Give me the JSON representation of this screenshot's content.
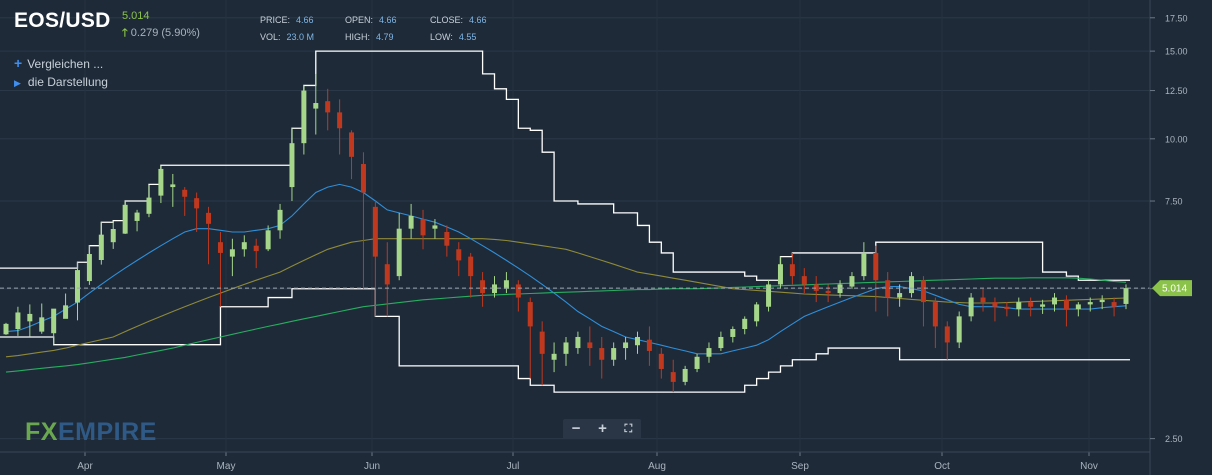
{
  "header": {
    "symbol": "EOS/USD",
    "last": "5.014",
    "change": "0.279 (5.90%)",
    "price_label": "PRICE:",
    "price": "4.66",
    "open_label": "OPEN:",
    "open": "4.66",
    "close_label": "CLOSE:",
    "close": "4.66",
    "vol_label": "VOL:",
    "vol": "23.0 M",
    "high_label": "HIGH:",
    "high": "4.79",
    "low_label": "LOW:",
    "low": "4.55"
  },
  "sidebar": {
    "compare": "Vergleichen ...",
    "display": "die Darstellung"
  },
  "logo": {
    "fx": "FX",
    "empire": "EMPIRE"
  },
  "zoom": {
    "minus": "−",
    "plus": "+",
    "fullscreen": "⛶"
  },
  "colors": {
    "background": "#1e2a38",
    "up": "#a5d68a",
    "down": "#c0391f",
    "ma_short": "#2f8fd8",
    "ma_mid": "#8e8a3a",
    "ma_long": "#27ae60",
    "channel": "#ffffff",
    "price_tag": "#8bc34a"
  },
  "chart_data": {
    "type": "candlestick",
    "y_scale": "log",
    "ylim": [
      2.35,
      19.0
    ],
    "y_ticks": [
      "2.50",
      "5.00",
      "7.50",
      "10.00",
      "12.50",
      "15.00",
      "17.50"
    ],
    "x_labels": [
      "Apr",
      "May",
      "Jun",
      "Jul",
      "Aug",
      "Sep",
      "Oct",
      "Nov"
    ],
    "last_price_tag": "5.014",
    "last_price": 5.014,
    "ohlc_shape": [
      [
        4.05,
        4.27,
        4.25,
        4.04
      ],
      [
        4.15,
        4.6,
        4.48,
        4.02
      ],
      [
        4.3,
        4.65,
        4.45,
        4.01
      ],
      [
        4.1,
        4.67,
        4.38,
        4.06
      ],
      [
        4.07,
        4.5,
        4.56,
        3.86
      ],
      [
        4.35,
        4.89,
        4.63,
        4.44
      ],
      [
        4.69,
        5.65,
        5.45,
        4.32
      ],
      [
        5.18,
        6.11,
        5.87,
        5.09
      ],
      [
        5.71,
        6.8,
        6.42,
        5.59
      ],
      [
        6.2,
        6.83,
        6.59,
        6.01
      ],
      [
        6.45,
        7.5,
        7.37,
        6.44
      ],
      [
        6.84,
        7.2,
        7.11,
        6.52
      ],
      [
        7.07,
        8.08,
        7.62,
        6.96
      ],
      [
        7.69,
        8.83,
        8.7,
        7.43
      ],
      [
        8.0,
        8.5,
        8.1,
        7.3
      ],
      [
        7.9,
        8.0,
        7.65,
        7.0
      ],
      [
        7.6,
        7.8,
        7.25,
        6.5
      ],
      [
        7.1,
        7.3,
        6.75,
        5.6
      ],
      [
        6.2,
        6.5,
        5.9,
        4.6
      ],
      [
        5.8,
        6.3,
        6.0,
        5.3
      ],
      [
        6.0,
        6.4,
        6.2,
        5.8
      ],
      [
        6.1,
        6.3,
        5.95,
        5.5
      ],
      [
        6.0,
        6.7,
        6.55,
        5.95
      ],
      [
        6.55,
        7.4,
        7.2,
        6.3
      ],
      [
        8.0,
        10.5,
        9.8,
        7.5
      ],
      [
        9.8,
        12.8,
        12.5,
        9.3
      ],
      [
        11.5,
        13.5,
        11.8,
        10.2
      ],
      [
        11.9,
        12.6,
        11.3,
        10.4
      ],
      [
        11.3,
        12.0,
        10.5,
        9.3
      ],
      [
        10.3,
        10.4,
        9.2,
        8.3
      ],
      [
        8.9,
        9.4,
        7.8,
        5.0
      ],
      [
        7.3,
        7.5,
        5.8,
        4.4
      ],
      [
        5.6,
        6.2,
        5.1,
        4.4
      ],
      [
        5.3,
        7.1,
        6.6,
        5.2
      ],
      [
        6.6,
        7.4,
        7.0,
        6.3
      ],
      [
        6.9,
        7.2,
        6.4,
        6.0
      ],
      [
        6.6,
        6.9,
        6.7,
        6.3
      ],
      [
        6.5,
        6.7,
        6.1,
        5.8
      ],
      [
        6.0,
        6.2,
        5.7,
        5.3
      ],
      [
        5.8,
        5.9,
        5.3,
        4.8
      ],
      [
        5.2,
        5.4,
        4.9,
        4.6
      ],
      [
        4.9,
        5.3,
        5.1,
        4.8
      ],
      [
        5.0,
        5.4,
        5.2,
        4.9
      ],
      [
        5.1,
        5.2,
        4.8,
        4.5
      ],
      [
        4.7,
        4.8,
        4.2,
        3.3
      ],
      [
        4.1,
        4.3,
        3.7,
        3.2
      ],
      [
        3.6,
        3.9,
        3.7,
        3.4
      ],
      [
        3.7,
        4.0,
        3.9,
        3.5
      ],
      [
        3.8,
        4.1,
        4.0,
        3.7
      ],
      [
        3.9,
        4.2,
        3.8,
        3.5
      ],
      [
        3.8,
        4.0,
        3.6,
        3.3
      ],
      [
        3.6,
        3.9,
        3.8,
        3.5
      ],
      [
        3.8,
        4.0,
        3.9,
        3.6
      ],
      [
        3.85,
        4.1,
        4.0,
        3.7
      ],
      [
        3.95,
        4.2,
        3.75,
        3.5
      ],
      [
        3.7,
        3.8,
        3.45,
        3.3
      ],
      [
        3.4,
        3.6,
        3.25,
        3.1
      ],
      [
        3.25,
        3.5,
        3.45,
        3.2
      ],
      [
        3.45,
        3.7,
        3.65,
        3.4
      ],
      [
        3.65,
        3.9,
        3.8,
        3.55
      ],
      [
        3.8,
        4.1,
        4.0,
        3.75
      ],
      [
        4.0,
        4.2,
        4.15,
        3.9
      ],
      [
        4.15,
        4.4,
        4.35,
        4.05
      ],
      [
        4.3,
        4.7,
        4.65,
        4.2
      ],
      [
        4.6,
        5.2,
        5.1,
        4.5
      ],
      [
        5.1,
        5.8,
        5.6,
        5.0
      ],
      [
        5.6,
        5.9,
        5.3,
        5.1
      ],
      [
        5.3,
        5.5,
        5.1,
        4.9
      ],
      [
        5.1,
        5.3,
        4.95,
        4.7
      ],
      [
        4.95,
        5.1,
        4.9,
        4.7
      ],
      [
        4.9,
        5.2,
        5.1,
        4.8
      ],
      [
        5.05,
        5.4,
        5.3,
        5.0
      ],
      [
        5.3,
        6.2,
        5.9,
        5.2
      ],
      [
        5.9,
        6.1,
        5.2,
        4.5
      ],
      [
        5.2,
        5.4,
        4.8,
        4.4
      ],
      [
        4.8,
        5.1,
        4.9,
        4.6
      ],
      [
        4.9,
        5.4,
        5.3,
        4.8
      ],
      [
        5.2,
        5.3,
        4.7,
        4.2
      ],
      [
        4.7,
        4.8,
        4.2,
        3.8
      ],
      [
        4.2,
        4.3,
        3.9,
        3.6
      ],
      [
        3.9,
        4.5,
        4.4,
        3.8
      ],
      [
        4.4,
        4.9,
        4.8,
        4.3
      ],
      [
        4.8,
        5.0,
        4.7,
        4.5
      ],
      [
        4.7,
        4.8,
        4.6,
        4.3
      ],
      [
        4.6,
        4.7,
        4.55,
        4.4
      ],
      [
        4.55,
        4.8,
        4.7,
        4.4
      ],
      [
        4.7,
        4.8,
        4.6,
        4.4
      ],
      [
        4.6,
        4.75,
        4.65,
        4.45
      ],
      [
        4.65,
        4.9,
        4.8,
        4.5
      ],
      [
        4.75,
        4.85,
        4.55,
        4.2
      ],
      [
        4.55,
        4.7,
        4.65,
        4.4
      ],
      [
        4.65,
        4.8,
        4.7,
        4.5
      ],
      [
        4.7,
        4.85,
        4.75,
        4.55
      ],
      [
        4.7,
        4.8,
        4.6,
        4.4
      ],
      [
        4.66,
        5.1,
        5.014,
        4.55
      ]
    ],
    "ma_short": [
      4.1,
      4.12,
      4.2,
      4.3,
      4.4,
      4.55,
      4.7,
      4.9,
      5.1,
      5.3,
      5.5,
      5.7,
      5.9,
      6.1,
      6.3,
      6.5,
      6.6,
      6.6,
      6.55,
      6.5,
      6.5,
      6.55,
      6.6,
      6.7,
      7.0,
      7.4,
      7.8,
      8.0,
      8.1,
      8.0,
      7.8,
      7.5,
      7.2,
      7.1,
      7.0,
      6.9,
      6.8,
      6.65,
      6.5,
      6.3,
      6.1,
      5.9,
      5.7,
      5.5,
      5.3,
      5.1,
      4.9,
      4.7,
      4.5,
      4.35,
      4.2,
      4.1,
      4.0,
      3.95,
      3.9,
      3.85,
      3.8,
      3.75,
      3.7,
      3.7,
      3.7,
      3.75,
      3.8,
      3.85,
      3.95,
      4.1,
      4.25,
      4.4,
      4.5,
      4.6,
      4.7,
      4.8,
      4.9,
      5.0,
      5.05,
      5.05,
      5.0,
      4.95,
      4.85,
      4.75,
      4.65,
      4.6,
      4.6,
      4.6,
      4.58,
      4.55,
      4.55,
      4.55,
      4.55,
      4.55,
      4.55,
      4.55,
      4.58,
      4.6,
      4.62
    ],
    "ma_mid": [
      3.65,
      3.67,
      3.7,
      3.73,
      3.76,
      3.8,
      3.85,
      3.9,
      3.95,
      4.0,
      4.1,
      4.2,
      4.3,
      4.4,
      4.5,
      4.6,
      4.7,
      4.8,
      4.9,
      5.0,
      5.1,
      5.2,
      5.3,
      5.4,
      5.55,
      5.7,
      5.85,
      6.0,
      6.1,
      6.2,
      6.25,
      6.3,
      6.3,
      6.3,
      6.3,
      6.3,
      6.3,
      6.3,
      6.3,
      6.3,
      6.3,
      6.28,
      6.25,
      6.2,
      6.15,
      6.1,
      6.05,
      6.0,
      5.9,
      5.8,
      5.7,
      5.6,
      5.5,
      5.4,
      5.35,
      5.3,
      5.25,
      5.2,
      5.15,
      5.1,
      5.05,
      5.0,
      4.98,
      4.96,
      4.94,
      4.92,
      4.9,
      4.88,
      4.87,
      4.86,
      4.85,
      4.84,
      4.83,
      4.82,
      4.8,
      4.78,
      4.76,
      4.74,
      4.72,
      4.7,
      4.69,
      4.68,
      4.68,
      4.68,
      4.69,
      4.7,
      4.71,
      4.72,
      4.73,
      4.74,
      4.75,
      4.76,
      4.77,
      4.78,
      4.79
    ],
    "ma_long": [
      3.4,
      3.42,
      3.44,
      3.46,
      3.48,
      3.5,
      3.52,
      3.55,
      3.58,
      3.61,
      3.64,
      3.68,
      3.72,
      3.76,
      3.8,
      3.85,
      3.9,
      3.95,
      4.0,
      4.05,
      4.1,
      4.15,
      4.2,
      4.25,
      4.3,
      4.35,
      4.4,
      4.45,
      4.5,
      4.55,
      4.6,
      4.63,
      4.66,
      4.69,
      4.72,
      4.75,
      4.77,
      4.79,
      4.81,
      4.83,
      4.85,
      4.86,
      4.87,
      4.88,
      4.89,
      4.9,
      4.91,
      4.92,
      4.93,
      4.94,
      4.95,
      4.96,
      4.97,
      4.98,
      4.98,
      4.99,
      5.0,
      5.0,
      5.0,
      5.01,
      5.02,
      5.03,
      5.04,
      5.05,
      5.06,
      5.07,
      5.08,
      5.09,
      5.1,
      5.11,
      5.12,
      5.13,
      5.14,
      5.15,
      5.16,
      5.17,
      5.18,
      5.19,
      5.2,
      5.21,
      5.22,
      5.23,
      5.24,
      5.25,
      5.25,
      5.25,
      5.26,
      5.26,
      5.26,
      5.26,
      5.25,
      5.23,
      5.2,
      5.17,
      5.15
    ],
    "channel_upper": [
      5.5,
      5.5,
      5.5,
      5.5,
      5.5,
      5.5,
      5.65,
      6.1,
      6.8,
      6.85,
      7.5,
      7.5,
      8.1,
      8.85,
      8.85,
      8.85,
      8.85,
      8.85,
      8.85,
      8.85,
      8.85,
      8.85,
      8.85,
      8.85,
      10.5,
      12.8,
      15.0,
      15.0,
      15.0,
      15.0,
      15.0,
      15.0,
      15.0,
      15.0,
      15.0,
      15.0,
      15.0,
      15.0,
      15.0,
      15.0,
      13.5,
      12.6,
      12.0,
      10.5,
      10.4,
      9.4,
      7.5,
      7.5,
      7.4,
      7.4,
      7.4,
      7.1,
      7.1,
      6.7,
      6.2,
      5.9,
      5.4,
      5.4,
      5.4,
      5.4,
      5.4,
      5.4,
      5.3,
      5.2,
      5.2,
      5.8,
      5.9,
      5.9,
      5.9,
      5.9,
      5.9,
      5.9,
      5.9,
      6.2,
      6.2,
      6.2,
      6.2,
      6.2,
      6.2,
      6.2,
      6.2,
      6.2,
      6.2,
      6.2,
      6.2,
      6.2,
      6.2,
      5.4,
      5.4,
      5.3,
      5.2,
      5.2,
      5.2,
      5.2,
      5.2
    ],
    "channel_lower": [
      4.0,
      4.0,
      4.0,
      4.0,
      3.86,
      3.86,
      3.86,
      3.86,
      3.86,
      3.86,
      3.86,
      3.86,
      3.86,
      3.86,
      3.86,
      3.86,
      3.86,
      3.86,
      4.6,
      4.6,
      4.6,
      4.6,
      4.8,
      4.8,
      5.0,
      5.0,
      5.0,
      5.0,
      5.0,
      5.0,
      5.0,
      4.4,
      4.4,
      3.5,
      3.5,
      3.5,
      3.5,
      3.5,
      3.5,
      3.5,
      3.5,
      3.5,
      3.5,
      3.3,
      3.2,
      3.2,
      3.1,
      3.1,
      3.1,
      3.1,
      3.1,
      3.1,
      3.1,
      3.1,
      3.1,
      3.1,
      3.1,
      3.1,
      3.1,
      3.1,
      3.1,
      3.1,
      3.2,
      3.3,
      3.4,
      3.5,
      3.6,
      3.6,
      3.7,
      3.8,
      3.8,
      3.8,
      3.8,
      3.8,
      3.8,
      3.6,
      3.6,
      3.6,
      3.6,
      3.6,
      3.6,
      3.6,
      3.6,
      3.6,
      3.6,
      3.6,
      3.6,
      3.6,
      3.6,
      3.6,
      3.6,
      3.6,
      3.6,
      3.6,
      3.6
    ]
  }
}
